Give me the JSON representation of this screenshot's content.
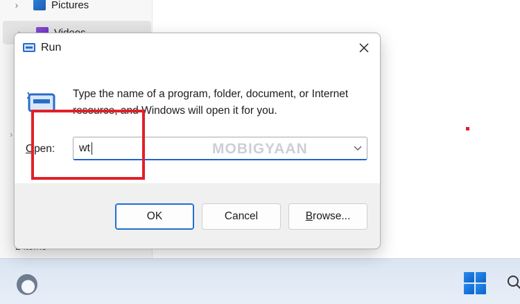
{
  "explorer": {
    "nav_items": [
      {
        "label": "Pictures",
        "icon": "pictures-folder-icon"
      },
      {
        "label": "Videos",
        "icon": "videos-folder-icon"
      }
    ],
    "status": "2 items"
  },
  "run_dialog": {
    "title": "Run",
    "prompt": "Type the name of a program, folder, document, or Internet resource, and Windows will open it for you.",
    "open_label_mnemonic": "O",
    "open_label_rest": "pen:",
    "open_value": "wt",
    "watermark": "MOBIGYAAN",
    "buttons": {
      "ok": "OK",
      "cancel": "Cancel",
      "browse_mnemonic": "B",
      "browse_rest": "rowse..."
    }
  },
  "annotation": {
    "color": "#e0202a"
  },
  "taskbar": {
    "icons": [
      "weather-icon",
      "windows-start-icon",
      "search-icon"
    ]
  }
}
